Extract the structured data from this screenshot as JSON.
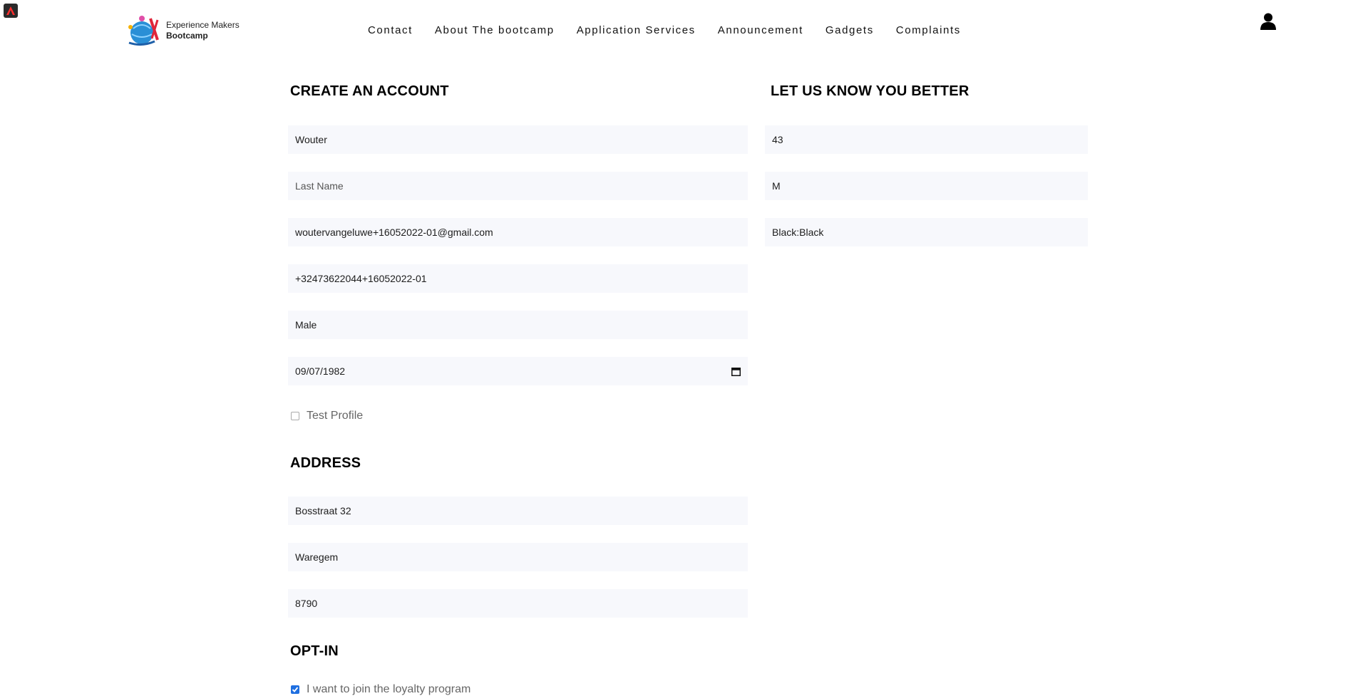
{
  "header": {
    "logo": {
      "line1": "Experience Makers",
      "line2": "Bootcamp"
    },
    "nav": [
      {
        "label": "Contact"
      },
      {
        "label": "About The bootcamp"
      },
      {
        "label": "Application Services"
      },
      {
        "label": "Announcement"
      },
      {
        "label": "Gadgets"
      },
      {
        "label": "Complaints"
      }
    ],
    "user_icon": "user-icon"
  },
  "account": {
    "title": "CREATE AN ACCOUNT",
    "first_name": {
      "value": "Wouter"
    },
    "last_name": {
      "value": "",
      "placeholder": "Last Name"
    },
    "email": {
      "value": "woutervangeluwe+16052022-01@gmail.com"
    },
    "phone": {
      "value": "+32473622044+16052022-01"
    },
    "gender": {
      "value": "Male"
    },
    "birthdate": {
      "value": "09/07/1982"
    },
    "test_profile": {
      "label": "Test Profile",
      "checked": false
    }
  },
  "know_you": {
    "title": "LET US KNOW YOU BETTER",
    "age": {
      "value": "43"
    },
    "size": {
      "value": "M"
    },
    "color": {
      "value": "Black:Black"
    }
  },
  "address": {
    "title": "ADDRESS",
    "street": {
      "value": "Bosstraat 32"
    },
    "city": {
      "value": "Waregem"
    },
    "postal_code": {
      "value": "8790"
    }
  },
  "optin": {
    "title": "OPT-IN",
    "loyalty": {
      "label": "I want to join the loyalty program",
      "checked": true
    }
  },
  "colors": {
    "checkbox_accent": "#1f6fe0",
    "field_bg": "#f7f8fc"
  }
}
